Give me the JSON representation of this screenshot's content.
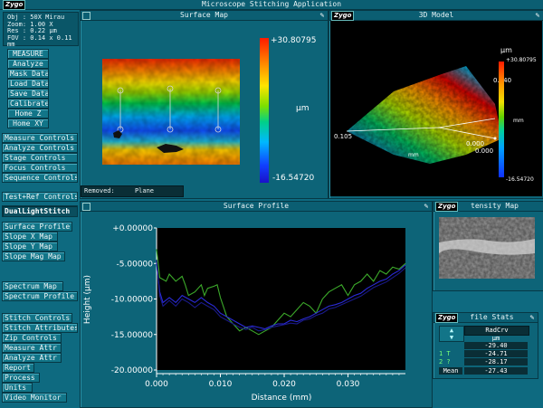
{
  "app": {
    "title": "Microscope Stitching Application",
    "logo": "Zygo"
  },
  "info": {
    "lines": [
      "Obj : 50X Mirau",
      "Zoom: 1.00 X",
      "Res : 0.22 µm",
      "FOV : 0.14 x 0.11 mm"
    ]
  },
  "sidebar": {
    "group1": [
      "MEASURE",
      "Analyze",
      "Mask Data",
      "Load Data",
      "Save Data",
      "Calibrate",
      "Home Z",
      "Home XY"
    ],
    "controls": [
      "Measure Controls",
      "Analyze Controls",
      "Stage Controls",
      "Focus Controls",
      "Sequence Controls"
    ],
    "test_ref": "Test+Ref Controls",
    "mode_selected": "DualLightStitch",
    "maps": [
      "Surface Profile",
      "Slope X Map",
      "Slope Y Map",
      "Slope Mag Map"
    ],
    "spectrum": [
      "Spectrum Map",
      "Spectrum Profile"
    ],
    "stitch": [
      "Stitch Controls",
      "Stitch Attributes",
      "Zip Controls",
      "Measure Attr",
      "Analyze Attr",
      "Report",
      "Process",
      "Units",
      "Video Monitor"
    ]
  },
  "surface_map": {
    "title": "Surface Map",
    "max": "+30.80795",
    "min": "-16.54720",
    "unit": "µm",
    "removed_label": "Removed:",
    "removed_value": "Plane"
  },
  "model3d": {
    "title": "3D Model",
    "unit": "µm",
    "max": "+30.80795",
    "min": "-16.54720",
    "axis1": "0.105",
    "axis2": "0.000",
    "axis3": "0.000",
    "axis4": "0.140",
    "mm_a": "mm",
    "mm_b": "mm"
  },
  "surface_profile": {
    "title": "Surface Profile"
  },
  "intensity_map": {
    "title": "Intensity Map",
    "visible_title": "tensity Map"
  },
  "profile_stats": {
    "title": "Profile Stats",
    "visible_title": "file Stats",
    "column": "RadCrv",
    "unit": "µm",
    "rows": [
      {
        "label": "",
        "value": "-29.40"
      },
      {
        "label": "1 T",
        "value": "-24.71"
      },
      {
        "label": "2 ?",
        "value": "-28.17"
      }
    ],
    "mean_label": "Mean",
    "mean_value": "-27.43"
  },
  "colors": {
    "teal": "#0d6478",
    "series_green": "#3caa2a",
    "series_blue": "#2a2ad8",
    "series_darkblue": "#1a1a8a"
  },
  "chart_data": {
    "type": "line",
    "xlabel": "Distance (mm)",
    "ylabel": "Height (µm)",
    "xlim": [
      0,
      0.039
    ],
    "ylim": [
      -20,
      0
    ],
    "xticks": [
      "0.000",
      "0.010",
      "0.020",
      "0.030"
    ],
    "xtick_values": [
      0,
      0.01,
      0.02,
      0.03
    ],
    "yticks": [
      "+0.00000",
      "-5.00000",
      "-10.00000",
      "-15.00000",
      "-20.00000"
    ],
    "ytick_values": [
      0,
      -5,
      -10,
      -15,
      -20
    ],
    "grid": false,
    "series": [
      {
        "color": "#3caa2a",
        "x": [
          0,
          0.0005,
          0.0015,
          0.002,
          0.003,
          0.004,
          0.0045,
          0.005,
          0.006,
          0.007,
          0.0075,
          0.008,
          0.009,
          0.0095,
          0.01,
          0.011,
          0.012,
          0.013,
          0.014,
          0.015,
          0.016,
          0.017,
          0.018,
          0.019,
          0.02,
          0.021,
          0.022,
          0.023,
          0.024,
          0.025,
          0.026,
          0.027,
          0.028,
          0.029,
          0.03,
          0.031,
          0.032,
          0.033,
          0.034,
          0.035,
          0.036,
          0.037,
          0.038,
          0.039
        ],
        "y": [
          -3.0,
          -7.0,
          -7.5,
          -6.5,
          -7.5,
          -6.8,
          -8.0,
          -9.5,
          -9.0,
          -8.0,
          -9.5,
          -8.5,
          -8.2,
          -8.0,
          -9.8,
          -12.5,
          -13.5,
          -14.5,
          -14.0,
          -14.5,
          -15.0,
          -14.5,
          -14.0,
          -13.0,
          -12.0,
          -12.5,
          -11.5,
          -10.5,
          -11.0,
          -12.0,
          -10.0,
          -9.0,
          -8.5,
          -8.0,
          -9.5,
          -8.0,
          -7.5,
          -6.5,
          -7.5,
          -6.0,
          -6.5,
          -5.5,
          -5.8,
          -5.0
        ]
      },
      {
        "color": "#2a2ad8",
        "x": [
          0,
          0.0005,
          0.001,
          0.002,
          0.003,
          0.004,
          0.005,
          0.006,
          0.007,
          0.008,
          0.009,
          0.01,
          0.011,
          0.012,
          0.013,
          0.014,
          0.015,
          0.016,
          0.017,
          0.018,
          0.019,
          0.02,
          0.021,
          0.022,
          0.023,
          0.024,
          0.025,
          0.026,
          0.027,
          0.028,
          0.029,
          0.03,
          0.031,
          0.032,
          0.033,
          0.034,
          0.035,
          0.036,
          0.037,
          0.038,
          0.039
        ],
        "y": [
          -5.0,
          -9.0,
          -10.5,
          -9.8,
          -10.5,
          -9.5,
          -10.0,
          -10.5,
          -9.8,
          -10.5,
          -11.0,
          -12.0,
          -12.5,
          -13.0,
          -13.5,
          -14.0,
          -13.8,
          -14.0,
          -14.2,
          -13.8,
          -13.5,
          -13.5,
          -13.0,
          -13.2,
          -12.8,
          -12.5,
          -12.0,
          -11.5,
          -11.0,
          -10.8,
          -10.5,
          -10.0,
          -9.5,
          -9.2,
          -8.5,
          -8.0,
          -7.5,
          -7.2,
          -6.5,
          -6.0,
          -5.2
        ]
      },
      {
        "color": "#1a1a8a",
        "x": [
          0,
          0.0005,
          0.001,
          0.002,
          0.003,
          0.004,
          0.005,
          0.006,
          0.007,
          0.008,
          0.009,
          0.01,
          0.011,
          0.012,
          0.013,
          0.014,
          0.015,
          0.016,
          0.017,
          0.018,
          0.019,
          0.02,
          0.021,
          0.022,
          0.023,
          0.024,
          0.025,
          0.026,
          0.027,
          0.028,
          0.029,
          0.03,
          0.031,
          0.032,
          0.033,
          0.034,
          0.035,
          0.036,
          0.037,
          0.038,
          0.039
        ],
        "y": [
          -4.5,
          -9.5,
          -11.0,
          -10.2,
          -11.0,
          -10.0,
          -10.5,
          -11.2,
          -10.5,
          -11.0,
          -11.5,
          -12.5,
          -13.0,
          -13.5,
          -14.0,
          -14.3,
          -14.0,
          -14.5,
          -14.3,
          -14.0,
          -13.8,
          -13.6,
          -13.4,
          -13.5,
          -13.0,
          -12.8,
          -12.3,
          -12.0,
          -11.4,
          -11.2,
          -10.8,
          -10.4,
          -10.0,
          -9.6,
          -9.0,
          -8.4,
          -8.0,
          -7.6,
          -7.0,
          -6.4,
          -5.6
        ]
      }
    ]
  }
}
